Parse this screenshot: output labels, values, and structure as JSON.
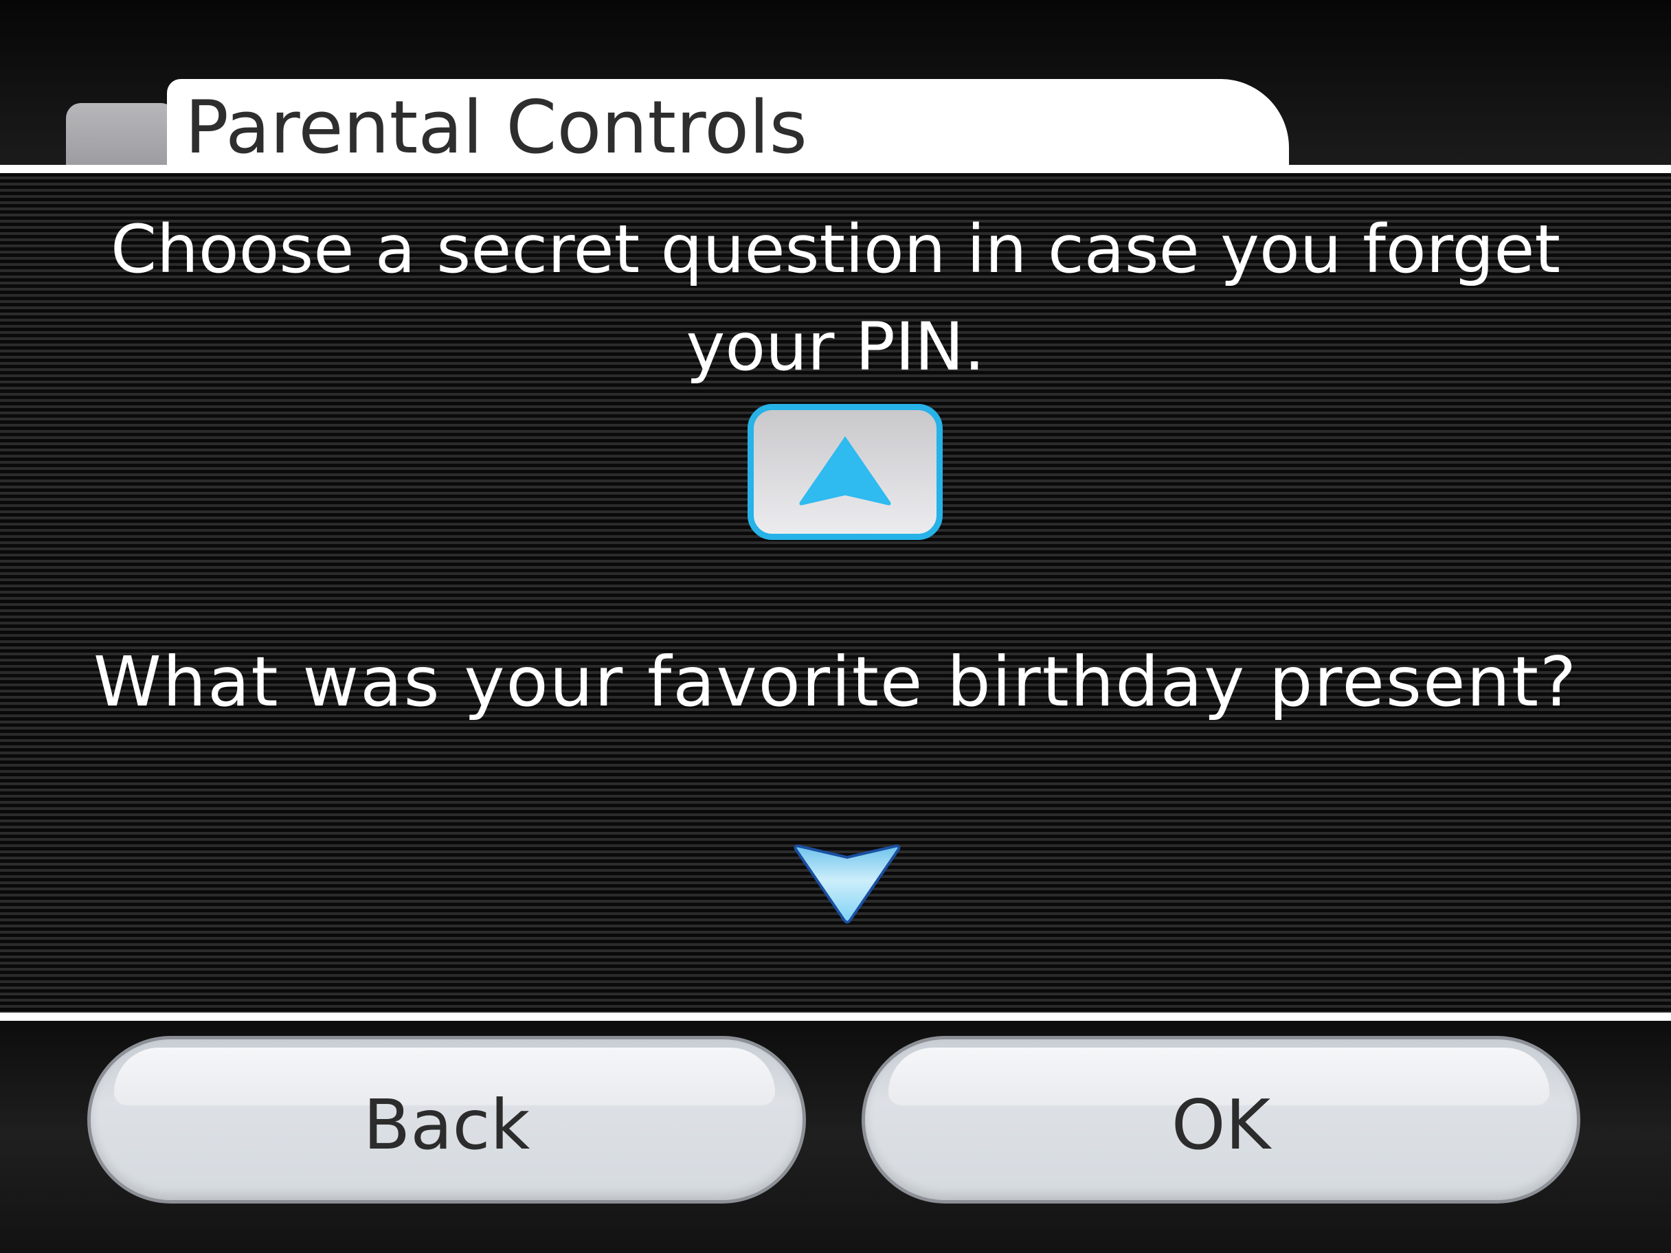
{
  "header": {
    "title": "Parental Controls"
  },
  "main": {
    "instruction": "Choose a secret question in case you forget your PIN.",
    "question": "What was your favorite birthday present?",
    "scroll_up_icon": "triangle-up-icon",
    "scroll_down_icon": "triangle-down-icon"
  },
  "footer": {
    "back_label": "Back",
    "ok_label": "OK"
  },
  "colors": {
    "accent": "#27b2e8",
    "arrow": "#2fbaf0",
    "title_text": "#2e2e2e",
    "button_text": "#2c2c2c"
  }
}
